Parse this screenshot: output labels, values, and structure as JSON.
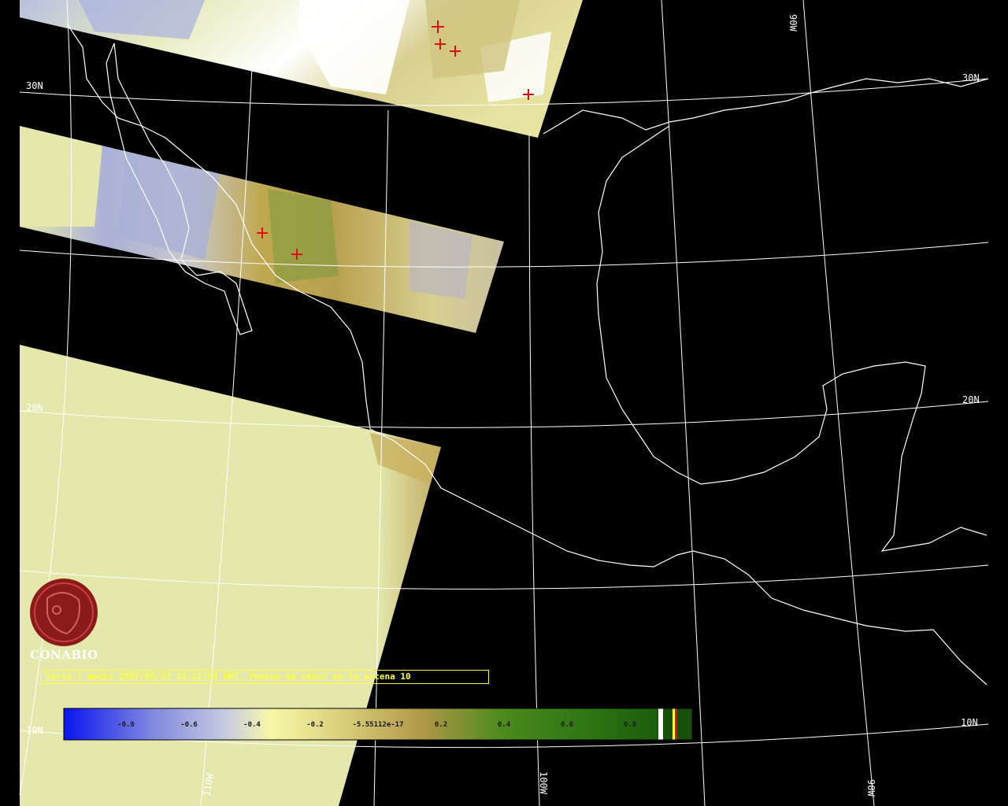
{
  "grid_labels": {
    "lat_30": "30N",
    "lat_30_east": "30N",
    "lat_20": "20N",
    "lat_20_east": "20N",
    "lat_10": "10N",
    "lat_10_east": "10N",
    "lon_110": "110W",
    "lon_100": "100W",
    "lon_90_top": "90W",
    "lon_90_bottom": "90W"
  },
  "logo": {
    "name": "CONABIO"
  },
  "caption": "Terra-1 modis 2007/05/23 18:11:58 GMT, Puntos de calor en la escena 10",
  "colorbar": {
    "labels": [
      "-0.8",
      "-0.6",
      "-0.4",
      "-0.2",
      "-5.55112e-17",
      "0.2",
      "0.4",
      "0.6",
      "0.8"
    ],
    "color_low": "#0a14ee",
    "color_mid": "#f0f0a0",
    "color_high": "#1e5a0e"
  },
  "hotspots": {
    "count": 6,
    "color": "#e01010"
  },
  "colors": {
    "coastline": "#ffffff",
    "graticule": "#ffffff",
    "swath_base": "#e4e8ac",
    "cloud": "#ffffff"
  }
}
